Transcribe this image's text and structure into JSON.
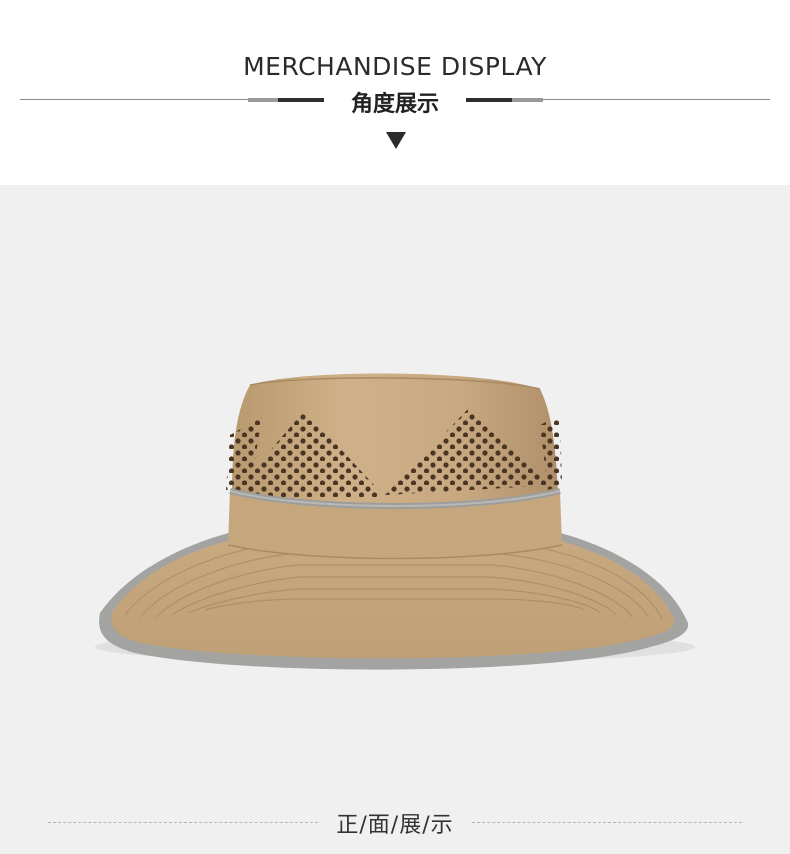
{
  "header": {
    "title_en": "MERCHANDISE DISPLAY",
    "title_cn": "角度展示"
  },
  "product": {
    "name": "bucket-hat",
    "color_body": "#c9ab83",
    "color_trim": "#9d9e9c"
  },
  "caption": "正/面/展/示",
  "colors": {
    "background_photo": "#f0f0f0",
    "accent_dark": "#2c2c2c"
  }
}
